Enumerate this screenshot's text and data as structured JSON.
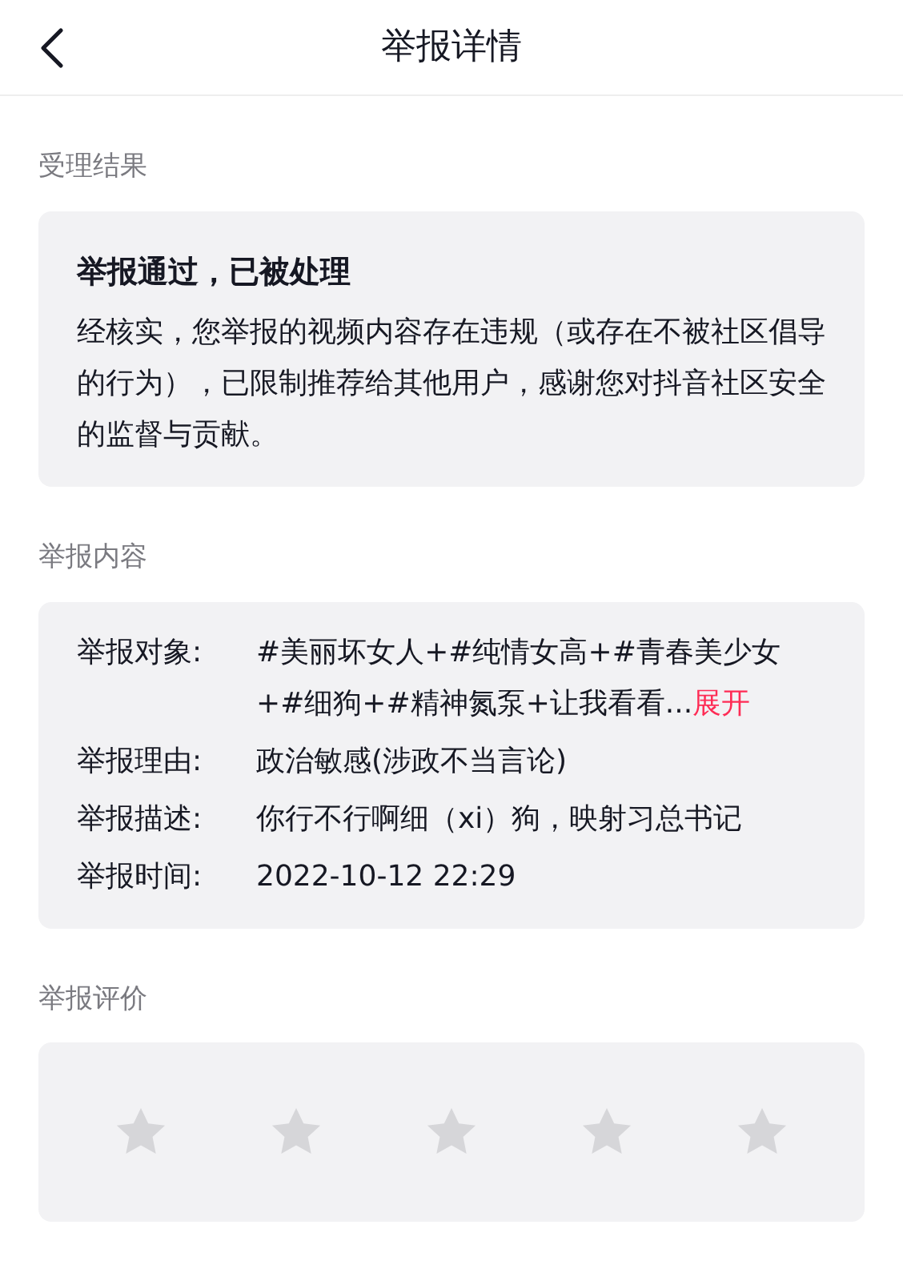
{
  "header": {
    "title": "举报详情"
  },
  "result": {
    "heading": "受理结果",
    "title": "举报通过，已被处理",
    "message": "经核实，您举报的视频内容存在违规（或存在不被社区倡导的行为），已限制推荐给其他用户，感谢您对抖音社区安全的监督与贡献。"
  },
  "content": {
    "heading": "举报内容",
    "rows": [
      {
        "label": "举报对象:",
        "value": "#美丽坏女人+#纯情女高+#青春美少女+#细狗+#精神氮泵+让我看看...",
        "link": "展开"
      },
      {
        "label": "举报理由:",
        "value": "政治敏感(涉政不当言论)"
      },
      {
        "label": "举报描述:",
        "value": "你行不行啊细（xi）狗，映射习总书记"
      },
      {
        "label": "举报时间:",
        "value": "2022-10-12 22:29"
      }
    ]
  },
  "rating": {
    "heading": "举报评价",
    "stars": 0
  }
}
